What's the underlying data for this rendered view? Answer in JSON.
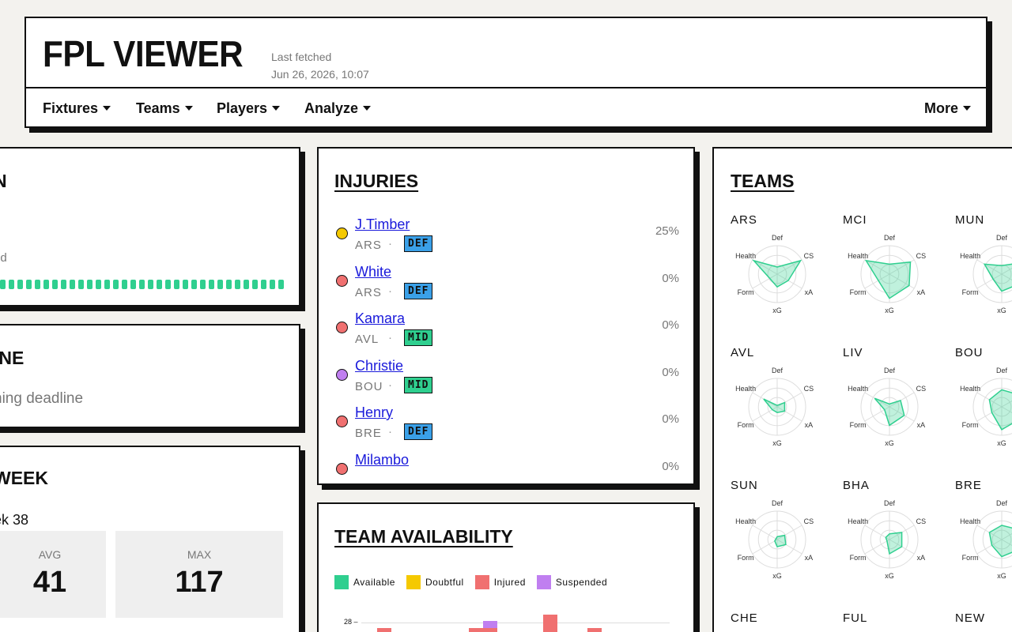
{
  "app": {
    "title": "FPL VIEWER",
    "fetched_label": "Last fetched",
    "fetched_time": "Jun 26, 2026, 10:07"
  },
  "nav": {
    "items": [
      "Fixtures",
      "Teams",
      "Players",
      "Analyze"
    ],
    "more": "More"
  },
  "left_cards": {
    "card1_title": "N",
    "card1_text": "ed",
    "card2_title": "INE",
    "card2_text": "ning deadline",
    "card3_title": "WEEK",
    "card3_sub": "ek 38",
    "avg_label": "AVG",
    "avg_value": "41",
    "max_label": "MAX",
    "max_value": "117"
  },
  "injuries": {
    "title": "INJURIES",
    "rows": [
      {
        "name": "J.Timber",
        "team": "ARS",
        "pos": "DEF",
        "pct": "25%",
        "status": "doubtful"
      },
      {
        "name": "White",
        "team": "ARS",
        "pos": "DEF",
        "pct": "0%",
        "status": "injured"
      },
      {
        "name": "Kamara",
        "team": "AVL",
        "pos": "MID",
        "pct": "0%",
        "status": "injured"
      },
      {
        "name": "Christie",
        "team": "BOU",
        "pos": "MID",
        "pct": "0%",
        "status": "suspended"
      },
      {
        "name": "Henry",
        "team": "BRE",
        "pos": "DEF",
        "pct": "0%",
        "status": "injured"
      },
      {
        "name": "Milambo",
        "team": "",
        "pos": "",
        "pct": "0%",
        "status": "injured"
      }
    ]
  },
  "availability": {
    "title": "TEAM AVAILABILITY",
    "legend": [
      "Available",
      "Doubtful",
      "Injured",
      "Suspended"
    ],
    "y_tick": "28"
  },
  "teams": {
    "title": "TEAMS",
    "axes": [
      "Def",
      "CS",
      "xA",
      "xG",
      "Form",
      "Health"
    ],
    "list": [
      "ARS",
      "MCI",
      "MUN",
      "AVL",
      "LIV",
      "BOU",
      "SUN",
      "BHA",
      "BRE",
      "CHE",
      "FUL",
      "NEW"
    ],
    "profiles": [
      [
        0.25,
        0.95,
        0.45,
        0.45,
        0.3,
        0.95
      ],
      [
        0.35,
        0.85,
        0.8,
        0.85,
        0.45,
        0.95
      ],
      [
        0.3,
        0.8,
        0.7,
        0.6,
        0.35,
        0.7
      ],
      [
        0.05,
        0.3,
        0.3,
        0.2,
        0.2,
        0.55
      ],
      [
        0.1,
        0.45,
        0.6,
        0.65,
        0.2,
        0.6
      ],
      [
        0.6,
        0.8,
        0.8,
        0.8,
        0.4,
        0.5
      ],
      [
        0.1,
        0.3,
        0.35,
        0.25,
        0.1,
        0.05
      ],
      [
        0.2,
        0.5,
        0.5,
        0.5,
        0.1,
        0.15
      ],
      [
        0.5,
        0.7,
        0.7,
        0.6,
        0.4,
        0.5
      ]
    ]
  },
  "colors": {
    "available": "#2fcf8f",
    "doubtful": "#f5c900",
    "injured": "#f07070",
    "suspended": "#c07ff0",
    "def": "#3aa0e8",
    "mid": "#2fcf8f"
  }
}
